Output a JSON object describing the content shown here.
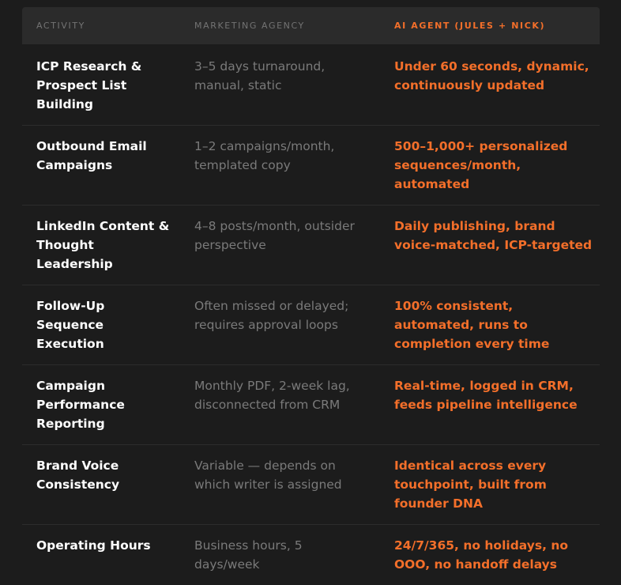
{
  "table": {
    "headers": {
      "activity": "ACTIVITY",
      "agency": "MARKETING AGENCY",
      "ai_agent": "AI AGENT (JULES + NICK)"
    },
    "rows": [
      {
        "activity": "ICP Research & Prospect List Building",
        "agency": "3–5 days turnaround, manual, static",
        "ai_agent": "Under 60 seconds, dynamic, continuously updated"
      },
      {
        "activity": "Outbound Email Campaigns",
        "agency": "1–2 campaigns/month, templated copy",
        "ai_agent": "500–1,000+ personalized sequences/month, automated"
      },
      {
        "activity": "LinkedIn Content & Thought Leadership",
        "agency": "4–8 posts/month, outsider perspective",
        "ai_agent": "Daily publishing, brand voice-matched, ICP-targeted"
      },
      {
        "activity": "Follow-Up Sequence Execution",
        "agency": "Often missed or delayed; requires approval loops",
        "ai_agent": "100% consistent, automated, runs to completion every time"
      },
      {
        "activity": "Campaign Performance Reporting",
        "agency": "Monthly PDF, 2-week lag, disconnected from CRM",
        "ai_agent": "Real-time, logged in CRM, feeds pipeline intelligence"
      },
      {
        "activity": "Brand Voice Consistency",
        "agency": "Variable — depends on which writer is assigned",
        "ai_agent": "Identical across every touchpoint, built from founder DNA"
      },
      {
        "activity": "Operating Hours",
        "agency": "Business hours, 5 days/week",
        "ai_agent": "24/7/365, no holidays, no OOO, no handoff delays"
      }
    ]
  },
  "colors": {
    "background": "#1c1c1c",
    "header_background": "#2b2b2b",
    "accent_orange": "#f36f2a",
    "activity_text": "#ffffff",
    "agency_text": "#7a7a7a",
    "header_text": "#737373"
  }
}
